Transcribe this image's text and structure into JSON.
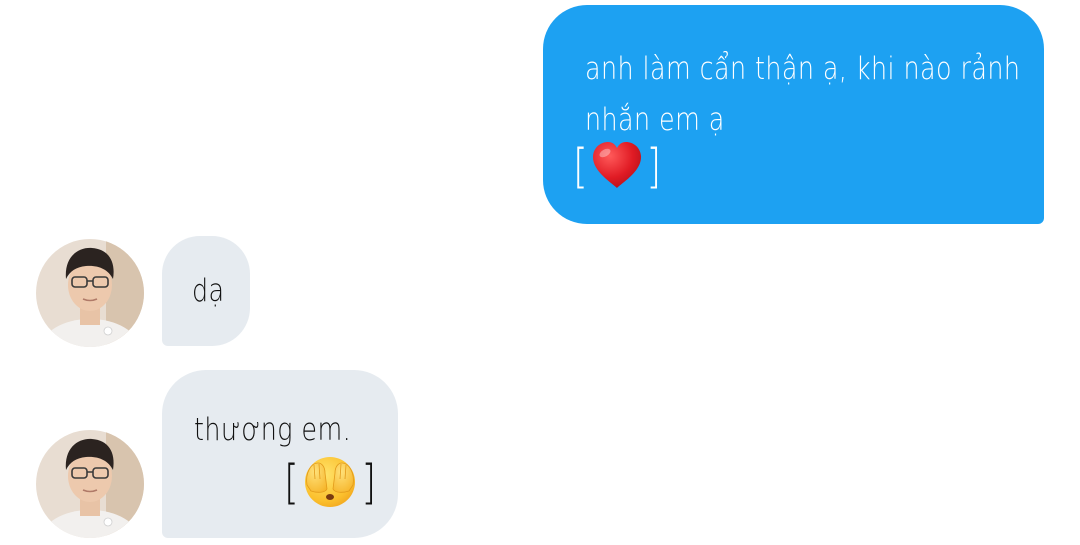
{
  "chat": {
    "messages": [
      {
        "sender": "me",
        "lines": [
          "anh làm cẩn thận ạ, khi nào rảnh",
          "nhắn em ạ"
        ],
        "emoji": {
          "open": "[",
          "close": "]",
          "icon": "red-heart"
        }
      },
      {
        "sender": "contact",
        "text": "dạ"
      },
      {
        "sender": "contact",
        "text": "thương em.",
        "emoji": {
          "open": "[",
          "close": "]",
          "icon": "face-with-hands-over-eyes"
        }
      }
    ]
  },
  "colors": {
    "outgoing_bubble": "#1da1f2",
    "incoming_bubble": "#e6ebf0",
    "outgoing_text": "#ffffff",
    "incoming_text": "#111111"
  }
}
